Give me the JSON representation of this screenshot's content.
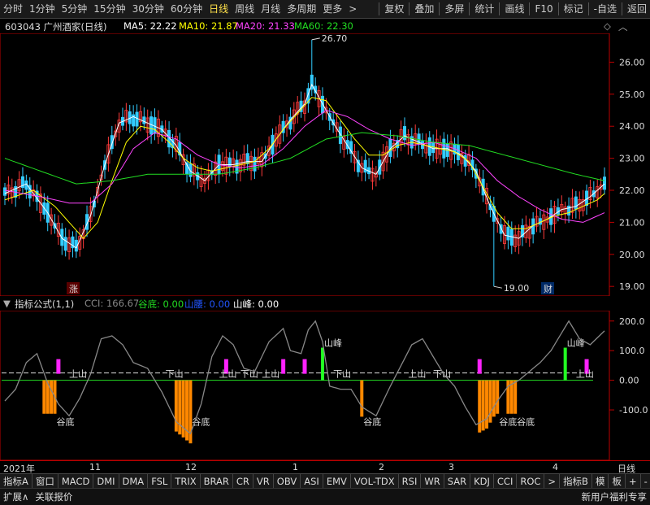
{
  "toolbar": {
    "periods": [
      "分时",
      "1分钟",
      "5分钟",
      "15分钟",
      "30分钟",
      "60分钟",
      "日线",
      "周线",
      "月线",
      "多周期",
      "更多"
    ],
    "active_period": "日线",
    "more_arrow": ">",
    "actions": [
      "复权",
      "叠加",
      "多屏",
      "统计",
      "画线",
      "F10",
      "标记",
      "-自选",
      "返回"
    ]
  },
  "stock": {
    "title": "603043 广州酒家(日线)",
    "ma5_label": "MA5: 22.22",
    "ma10_label": "MA10: 21.87",
    "ma20_label": "MA20: 21.33",
    "ma60_label": "MA60: 22.30",
    "high_label": "26.70",
    "low_label": "19.00",
    "marker_zhang": "涨",
    "marker_cai": "财",
    "colors": {
      "ma5": "#ffffff",
      "ma10": "#ffff00",
      "ma20": "#ff44ff",
      "ma60": "#22dd22",
      "up": "#ff3b3b",
      "down": "#33ccff"
    }
  },
  "indicator": {
    "name": "指标公式(1,1)",
    "cci_label": "CCI: 166.67",
    "gudi_label": "谷底: 0.00",
    "shanyao_label": "山腰: 0.00",
    "shanfeng_label": "山峰: 0.00",
    "ticks": [
      "200.0",
      "100.0",
      "0.00",
      "-100.0"
    ],
    "annotations": {
      "shanfeng": "山峰",
      "shangshan": "上山",
      "xiashan": "下山",
      "gudi": "谷底"
    }
  },
  "chart_data": [
    {
      "type": "candlestick",
      "title": "603043 广州酒家(日线)",
      "y_ticks": [
        19.0,
        20.0,
        21.0,
        22.0,
        23.0,
        24.0,
        25.0,
        26.0
      ],
      "ylim": [
        18.7,
        26.9
      ],
      "annotated_high": 26.7,
      "annotated_low": 19.0,
      "ma5_path": [
        [
          0,
          21.9
        ],
        [
          6,
          22.2
        ],
        [
          12,
          21.3
        ],
        [
          16,
          20.5
        ],
        [
          20,
          20.2
        ],
        [
          24,
          21.2
        ],
        [
          28,
          22.8
        ],
        [
          32,
          24.1
        ],
        [
          36,
          24.3
        ],
        [
          40,
          24.1
        ],
        [
          44,
          23.9
        ],
        [
          48,
          23.4
        ],
        [
          52,
          22.6
        ],
        [
          56,
          22.3
        ],
        [
          60,
          22.8
        ],
        [
          64,
          22.8
        ],
        [
          68,
          22.9
        ],
        [
          72,
          22.9
        ],
        [
          76,
          23.6
        ],
        [
          80,
          24.2
        ],
        [
          84,
          24.7
        ],
        [
          86,
          25.3
        ],
        [
          88,
          24.9
        ],
        [
          92,
          24.1
        ],
        [
          96,
          23.4
        ],
        [
          100,
          22.7
        ],
        [
          104,
          22.5
        ],
        [
          108,
          23.3
        ],
        [
          112,
          23.7
        ],
        [
          116,
          23.5
        ],
        [
          120,
          23.3
        ],
        [
          124,
          23.3
        ],
        [
          128,
          23.1
        ],
        [
          132,
          22.6
        ],
        [
          136,
          21.5
        ],
        [
          140,
          20.6
        ],
        [
          144,
          20.5
        ],
        [
          148,
          20.9
        ],
        [
          152,
          21.1
        ],
        [
          156,
          21.4
        ],
        [
          160,
          21.5
        ],
        [
          164,
          21.8
        ],
        [
          168,
          22.2
        ]
      ],
      "ma10_path": [
        [
          0,
          21.7
        ],
        [
          8,
          22.0
        ],
        [
          14,
          21.5
        ],
        [
          18,
          21.0
        ],
        [
          22,
          20.5
        ],
        [
          26,
          21.0
        ],
        [
          30,
          22.3
        ],
        [
          34,
          23.5
        ],
        [
          38,
          24.0
        ],
        [
          42,
          23.9
        ],
        [
          46,
          23.5
        ],
        [
          50,
          23.0
        ],
        [
          54,
          22.7
        ],
        [
          58,
          22.6
        ],
        [
          62,
          22.7
        ],
        [
          66,
          22.8
        ],
        [
          70,
          22.9
        ],
        [
          74,
          23.3
        ],
        [
          78,
          23.9
        ],
        [
          82,
          24.4
        ],
        [
          86,
          24.9
        ],
        [
          90,
          24.8
        ],
        [
          94,
          24.2
        ],
        [
          98,
          23.6
        ],
        [
          102,
          23.1
        ],
        [
          106,
          23.1
        ],
        [
          110,
          23.4
        ],
        [
          114,
          23.5
        ],
        [
          118,
          23.4
        ],
        [
          122,
          23.3
        ],
        [
          126,
          23.2
        ],
        [
          130,
          22.9
        ],
        [
          134,
          22.1
        ],
        [
          138,
          21.3
        ],
        [
          142,
          20.8
        ],
        [
          146,
          20.8
        ],
        [
          150,
          21.0
        ],
        [
          154,
          21.2
        ],
        [
          158,
          21.3
        ],
        [
          162,
          21.5
        ],
        [
          166,
          21.7
        ],
        [
          168,
          21.9
        ]
      ],
      "ma20_path": [
        [
          0,
          22.0
        ],
        [
          10,
          21.8
        ],
        [
          18,
          21.6
        ],
        [
          24,
          21.6
        ],
        [
          30,
          22.2
        ],
        [
          36,
          23.3
        ],
        [
          42,
          23.8
        ],
        [
          48,
          23.6
        ],
        [
          54,
          23.1
        ],
        [
          60,
          22.8
        ],
        [
          66,
          22.7
        ],
        [
          72,
          22.8
        ],
        [
          78,
          23.3
        ],
        [
          84,
          24.0
        ],
        [
          90,
          24.5
        ],
        [
          96,
          24.3
        ],
        [
          102,
          23.9
        ],
        [
          108,
          23.6
        ],
        [
          114,
          23.4
        ],
        [
          120,
          23.5
        ],
        [
          126,
          23.3
        ],
        [
          132,
          23.0
        ],
        [
          138,
          22.3
        ],
        [
          144,
          21.8
        ],
        [
          150,
          21.4
        ],
        [
          156,
          21.1
        ],
        [
          162,
          21.0
        ],
        [
          168,
          21.3
        ]
      ],
      "ma60_path": [
        [
          0,
          23.0
        ],
        [
          10,
          22.6
        ],
        [
          20,
          22.2
        ],
        [
          30,
          22.3
        ],
        [
          40,
          22.5
        ],
        [
          50,
          22.5
        ],
        [
          60,
          22.5
        ],
        [
          70,
          22.7
        ],
        [
          80,
          23.0
        ],
        [
          90,
          23.6
        ],
        [
          100,
          23.8
        ],
        [
          110,
          23.7
        ],
        [
          120,
          23.5
        ],
        [
          130,
          23.4
        ],
        [
          140,
          23.1
        ],
        [
          150,
          22.8
        ],
        [
          160,
          22.5
        ],
        [
          168,
          22.3
        ]
      ]
    },
    {
      "type": "line",
      "name": "CCI",
      "y_ticks": [
        200,
        100,
        0,
        -100
      ],
      "ylim": [
        -270,
        235
      ],
      "cci_path": [
        [
          0,
          -70
        ],
        [
          3,
          -30
        ],
        [
          6,
          60
        ],
        [
          9,
          90
        ],
        [
          12,
          -10
        ],
        [
          15,
          -80
        ],
        [
          18,
          -120
        ],
        [
          21,
          -60
        ],
        [
          24,
          20
        ],
        [
          27,
          140
        ],
        [
          30,
          150
        ],
        [
          33,
          120
        ],
        [
          36,
          60
        ],
        [
          40,
          40
        ],
        [
          44,
          -40
        ],
        [
          48,
          -140
        ],
        [
          52,
          -180
        ],
        [
          55,
          -80
        ],
        [
          58,
          80
        ],
        [
          61,
          150
        ],
        [
          64,
          120
        ],
        [
          67,
          40
        ],
        [
          70,
          30
        ],
        [
          74,
          130
        ],
        [
          78,
          175
        ],
        [
          80,
          100
        ],
        [
          83,
          90
        ],
        [
          85,
          170
        ],
        [
          87,
          200
        ],
        [
          89,
          130
        ],
        [
          91,
          -20
        ],
        [
          94,
          -30
        ],
        [
          97,
          -30
        ],
        [
          100,
          -90
        ],
        [
          104,
          -120
        ],
        [
          108,
          -20
        ],
        [
          111,
          50
        ],
        [
          114,
          120
        ],
        [
          117,
          140
        ],
        [
          120,
          80
        ],
        [
          123,
          20
        ],
        [
          126,
          -20
        ],
        [
          129,
          -90
        ],
        [
          132,
          -150
        ],
        [
          135,
          -130
        ],
        [
          138,
          -70
        ],
        [
          141,
          -20
        ],
        [
          144,
          0
        ],
        [
          147,
          30
        ],
        [
          150,
          60
        ],
        [
          153,
          100
        ],
        [
          156,
          160
        ],
        [
          158,
          200
        ],
        [
          161,
          140
        ],
        [
          164,
          120
        ],
        [
          168,
          166.67
        ]
      ],
      "current": 166.67
    }
  ],
  "dates": {
    "labels": [
      "2021年",
      "11",
      "12",
      "1",
      "2",
      "3",
      "4"
    ],
    "period": "日线"
  },
  "tabs": [
    "指标A",
    "窗口",
    "MACD",
    "DMI",
    "DMA",
    "FSL",
    "TRIX",
    "BRAR",
    "CR",
    "VR",
    "OBV",
    "ASI",
    "EMV",
    "VOL-TDX",
    "RSI",
    "WR",
    "SAR",
    "KDJ",
    "CCI",
    "ROC",
    ">",
    "指标B",
    "模",
    "板",
    "+",
    "-"
  ],
  "bottom": {
    "left": [
      "扩展∧",
      "关联报价"
    ],
    "right": "新用户福利专享"
  }
}
